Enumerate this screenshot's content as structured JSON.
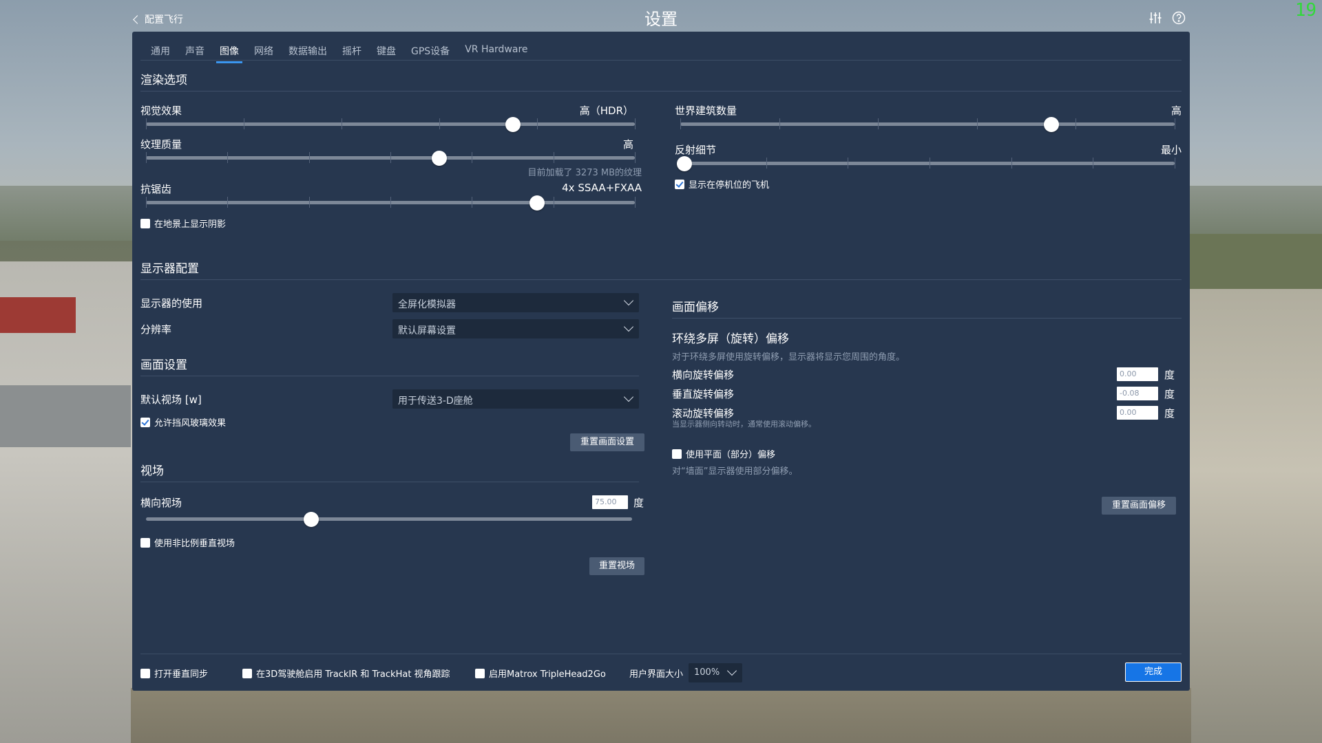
{
  "header": {
    "back_label": "配置飞行",
    "title": "设置",
    "icons": [
      "sliders-icon",
      "help-icon"
    ],
    "fps": "19"
  },
  "tabs": [
    {
      "label": "通用",
      "active": false
    },
    {
      "label": "声音",
      "active": false
    },
    {
      "label": "图像",
      "active": true
    },
    {
      "label": "网络",
      "active": false
    },
    {
      "label": "数据输出",
      "active": false
    },
    {
      "label": "摇杆",
      "active": false
    },
    {
      "label": "键盘",
      "active": false
    },
    {
      "label": "GPS设备",
      "active": false
    },
    {
      "label": "VR Hardware",
      "active": false
    }
  ],
  "render": {
    "heading": "渲染选项",
    "visual_effects": {
      "label": "视觉效果",
      "value": "高（HDR）",
      "level": 0.75
    },
    "texture_quality": {
      "label": "纹理质量",
      "value": "高",
      "level": 0.6,
      "note": "目前加载了 3273 MB的纹理"
    },
    "antialiasing": {
      "label": "抗锯齿",
      "value": "4x SSAA+FXAA",
      "level": 0.8
    },
    "shadows_checkbox": {
      "label": "在地景上显示阴影",
      "checked": false
    },
    "world_objects": {
      "label": "世界建筑数量",
      "value": "高",
      "level": 0.75
    },
    "reflection_detail": {
      "label": "反射细节",
      "value": "最小",
      "level": 0.0
    },
    "parked_aircraft": {
      "label": "显示在停机位的飞机",
      "checked": true
    }
  },
  "display": {
    "heading": "显示器配置",
    "monitor_use": {
      "label": "显示器的使用",
      "value": "全屏化模拟器"
    },
    "resolution": {
      "label": "分辨率",
      "value": "默认屏幕设置"
    }
  },
  "view_settings": {
    "heading": "画面设置",
    "default_fov": {
      "label": "默认视场 [w]",
      "value": "用于传送3-D座舱"
    },
    "windshield": {
      "label": "允许挡风玻璃效果",
      "checked": true
    },
    "reset_button": "重置画面设置"
  },
  "fov": {
    "heading": "视场",
    "horizontal": {
      "label": "横向视场",
      "value": "75.00",
      "unit": "度",
      "level": 0.34
    },
    "non_proportional": {
      "label": "使用非比例垂直视场",
      "checked": false
    },
    "reset_button": "重置视场"
  },
  "offset": {
    "heading": "画面偏移",
    "subheading": "环绕多屏（旋转）偏移",
    "description": "对于环绕多屏使用旋转偏移，显示器将显示您周围的角度。",
    "lateral": {
      "label": "横向旋转偏移",
      "value": "0.00",
      "unit": "度"
    },
    "vertical": {
      "label": "垂直旋转偏移",
      "value": "-0.08",
      "unit": "度"
    },
    "roll": {
      "label": "滚动旋转偏移",
      "value": "0.00",
      "unit": "度",
      "note": "当显示器侧向转动时，通常使用滚动偏移。"
    },
    "planar": {
      "label": "使用平面（部分）偏移",
      "checked": false
    },
    "planar_note": "对“墙面”显示器使用部分偏移。",
    "reset_button": "重置画面偏移"
  },
  "footer": {
    "vsync": {
      "label": "打开垂直同步",
      "checked": false
    },
    "trackir": {
      "label": "在3D驾驶舱启用 TrackIR 和 TrackHat 视角跟踪",
      "checked": false
    },
    "matrox": {
      "label": "启用Matrox TripleHead2Go",
      "checked": false
    },
    "ui_size_label": "用户界面大小",
    "ui_size_value": "100%",
    "done_button": "完成"
  },
  "colors": {
    "panel": "#27374f",
    "accent": "#1675e6",
    "tab_underline": "#3b96ef"
  }
}
